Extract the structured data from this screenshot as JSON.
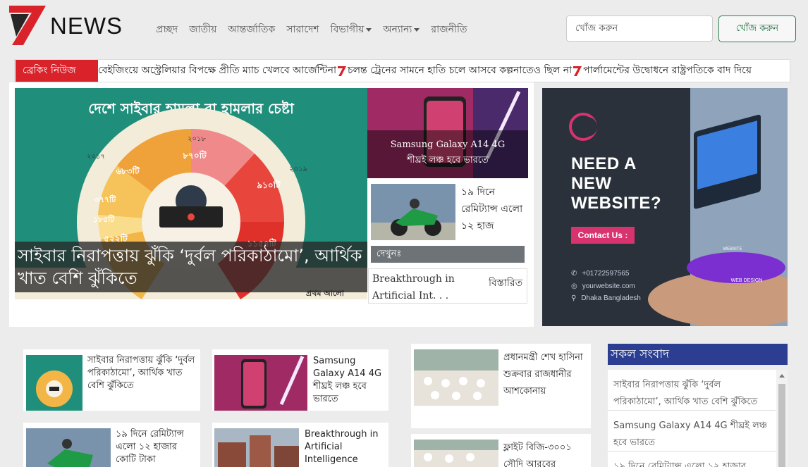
{
  "header": {
    "logo_text": "NEWS",
    "nav": [
      {
        "label": "প্রচ্ছদ",
        "dropdown": false
      },
      {
        "label": "জাতীয়",
        "dropdown": false
      },
      {
        "label": "আন্তর্জাতিক",
        "dropdown": false
      },
      {
        "label": "সারাদেশ",
        "dropdown": false
      },
      {
        "label": "বিভাগীয়",
        "dropdown": true
      },
      {
        "label": "অন্যান্য",
        "dropdown": true
      },
      {
        "label": "রাজনীতি",
        "dropdown": false
      }
    ],
    "search_placeholder": "খোঁজ করুন",
    "search_button": "খোঁজ করুন"
  },
  "breaking": {
    "label": "ব্রেকিং নিউজ",
    "items": [
      "বেইজিংয়ে অস্ট্রেলিয়ার বিপক্ষে প্রীতি ম্যাচ খেলবে আর্জেন্টিনা",
      "চলন্ত ট্রেনের সামনে হাতি চলে আসবে কল্পনাতেও ছিল না",
      "পার্লামেন্টের উদ্বোধনে রাষ্ট্রপতিকে বাদ দিয়ে"
    ]
  },
  "featured": {
    "image_title": "দেশে সাইবার হামলা বা হামলার চেষ্টা",
    "image_years": [
      "২০১৮",
      "২০১৭",
      "২০১৯"
    ],
    "image_values": [
      "৮৭০টি",
      "৬৮৩টি",
      "৯১০টি",
      "৩৭৭টি",
      "১৮৫টি",
      "৫২২টি",
      "১১৫৪টি"
    ],
    "image_credit": "প্রথম আলো",
    "headline": "সাইবার নিরাপত্তায় ঝুঁকি ‘দুর্বল পরিকাঠামো’, আর্থিক খাত বেশি ঝুঁকিতে",
    "side1_line1": "Samsung Galaxy A14 4G",
    "side1_line2": "শীঘ্রই লঞ্চ হবে ভারতে",
    "side2_text": "১৯ দিনে রেমিট্যান্স এলো ১২ হাজ",
    "dekhun": "দেখুনঃ",
    "mini_title": "Breakthrough in Artificial Int. . .",
    "mini_more": "বিস্তারিত"
  },
  "ad": {
    "heading_lines": [
      "NEED A",
      "NEW",
      "WEBSITE?"
    ],
    "button": "Contact Us :",
    "phone": "+01722597565",
    "website": "yourwebsite.com",
    "location": "Dhaka Bangladesh",
    "laptop_label": "WEBSITE",
    "platform_label": "WEB DESIGN"
  },
  "cards": {
    "c1": "সাইবার নিরাপত্তায় ঝুঁকি ‘দুর্বল পরিকাঠামো’, আর্থিক খাত বেশি ঝুঁকিতে",
    "c2": "Samsung Galaxy A14 4G শীঘ্রই লঞ্চ হবে ভারতে",
    "c3": "প্রধানমন্ত্রী শেখ হাসিনা শুক্রবার রাজধানীর আশকোনায়",
    "c4": "১৯ দিনে রেমিট্যান্স এলো ১২ হাজার কোটি টাকা",
    "c5": "Breakthrough in Artificial Intelligence",
    "c6": "ফ্লাইট বিজি-৩০০১ সৌদি আরবের"
  },
  "all_news": {
    "title": "সকল সংবাদ",
    "items": [
      "সাইবার নিরাপত্তায় ঝুঁকি ‘দুর্বল পরিকাঠামো’, আর্থিক খাত বেশি ঝুঁকিতে",
      "Samsung Galaxy A14 4G শীঘ্রই লঞ্চ হবে ভারতে",
      "১৯ দিনে রেমিট্যান্স এলো ১২ হাজার"
    ]
  },
  "colors": {
    "brand_red": "#d9222a",
    "section_blue": "#2c3e91",
    "button_green": "#1f6b3f"
  }
}
